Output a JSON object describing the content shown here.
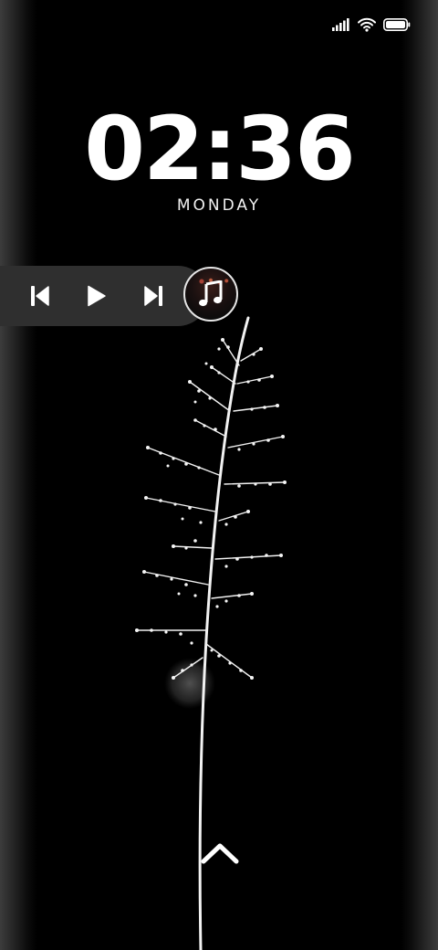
{
  "status_bar": {
    "icons": [
      "cellular-signal-icon",
      "wifi-icon",
      "battery-icon"
    ]
  },
  "lock_screen": {
    "time": "02:36",
    "day": "MONDAY"
  },
  "media_controls": {
    "icons": [
      "skip-previous-icon",
      "play-icon",
      "skip-next-icon",
      "music-note-icon"
    ]
  },
  "gesture": {
    "icon": "chevron-up-icon"
  },
  "colors": {
    "background": "#000000",
    "text": "#ffffff",
    "media_bar": "#2f2f2f"
  }
}
